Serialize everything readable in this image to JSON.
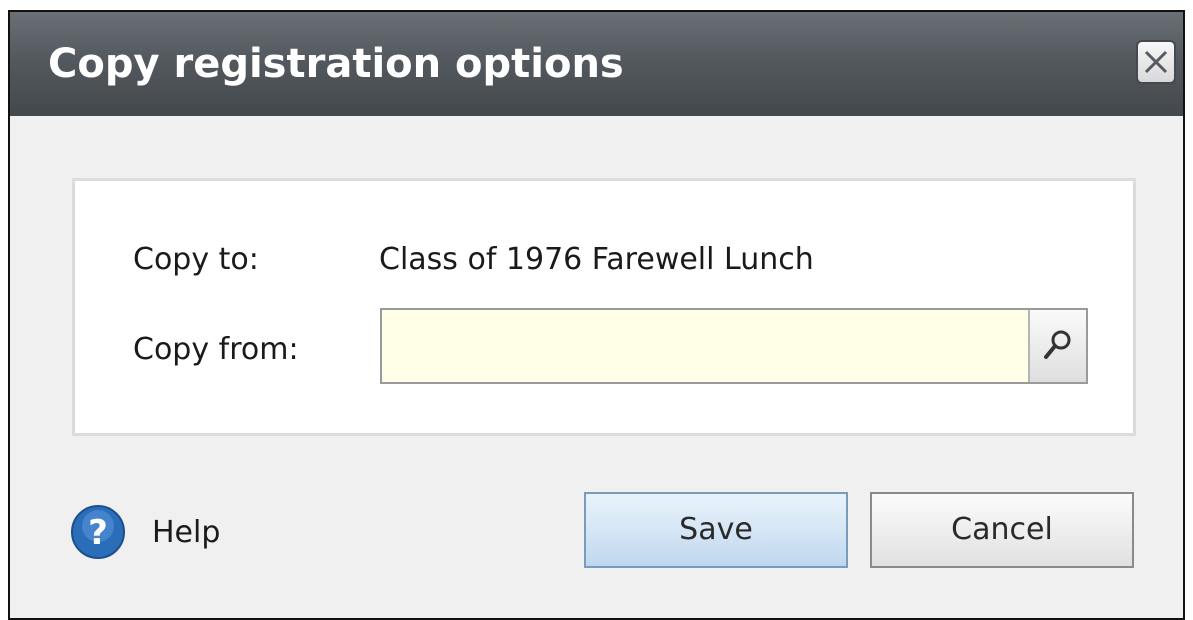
{
  "dialog": {
    "title": "Copy registration options"
  },
  "form": {
    "copy_to_label": "Copy to:",
    "copy_to_value": "Class of 1976 Farewell Lunch",
    "copy_from_label": "Copy from:",
    "copy_from_value": "",
    "copy_from_placeholder": ""
  },
  "footer": {
    "help_label": "Help",
    "save_label": "Save",
    "cancel_label": "Cancel"
  },
  "icons": {
    "close": "close-icon",
    "search": "search-icon",
    "help": "help-icon"
  },
  "colors": {
    "titlebar": "#53595e",
    "input_bg": "#ffffe8",
    "save_button": "#d5e6f5",
    "help_icon": "#2a6db8"
  }
}
